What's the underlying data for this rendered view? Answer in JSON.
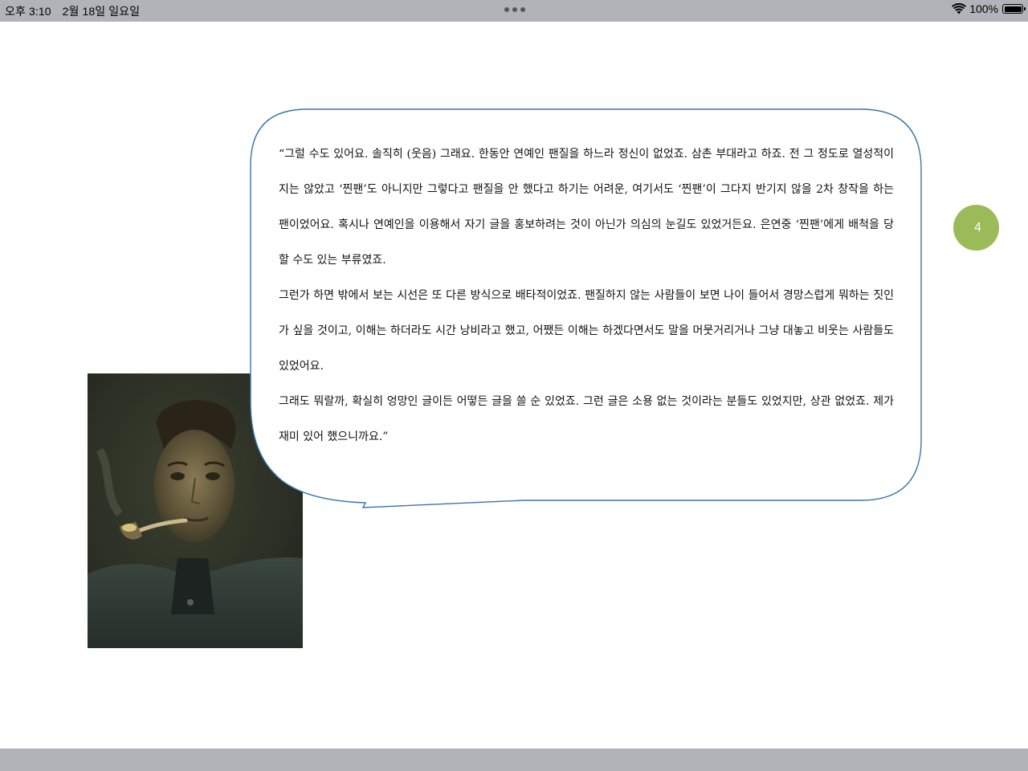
{
  "status_bar": {
    "time": "오후 3:10",
    "date": "2월 18일 일요일",
    "battery_percent": "100%",
    "wifi_icon": "wifi-icon",
    "battery_icon": "battery-full-icon",
    "multitask_icon": "multitask-dots-icon"
  },
  "page": {
    "number": "4",
    "badge_color": "#9bbb59",
    "bubble_border_color": "#3a74a8"
  },
  "quote": {
    "paragraphs": [
      "“그럴 수도 있어요. 솔직히 (웃음) 그래요. 한동안 연예인 팬질을 하느라 정신이 없었죠. 삼촌 부대라고 하죠. 전 그 정도로 열성적이지는 않았고 ‘찐팬’도 아니지만 그렇다고 팬질을 안 했다고 하기는 어려운, 여기서도 ‘찐팬’이 그다지 반기지 않을 2차 창작을 하는 팬이었어요. 혹시나 연예인을 이용해서 자기 글을 홍보하려는 것이 아닌가 의심의 눈길도 있었거든요. 은연중 ‘찐팬’에게 배척을 당할 수도 있는 부류였죠.",
      "그런가 하면 밖에서 보는 시선은 또 다른 방식으로 배타적이었죠. 팬질하지 않는 사람들이 보면 나이 들어서 경망스럽게 뭐하는 짓인가 싶을 것이고, 이해는 하더라도 시간 낭비라고 했고, 어쨌든 이해는 하겠다면서도 말을 머뭇거리거나 그냥 대놓고 비웃는 사람들도 있었어요.",
      "그래도 뭐랄까, 확실히 엉망인 글이든 어떻든 글을 쓸 순 있었죠. 그런 글은 소용 없는 것이라는 분들도 있었지만, 상관 없었죠. 제가 재미 있어 했으니까요.”"
    ]
  }
}
